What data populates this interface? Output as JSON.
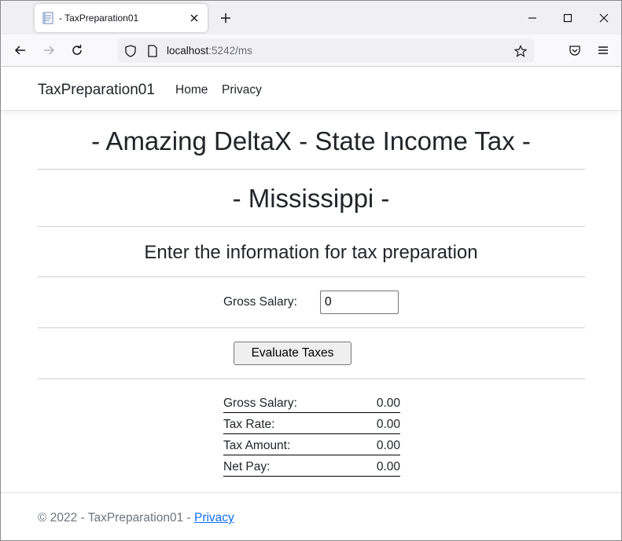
{
  "browser": {
    "tab_title": "- TaxPreparation01",
    "url_host": "localhost",
    "url_rest": ":5242/ms"
  },
  "site": {
    "brand": "TaxPreparation01",
    "nav": [
      "Home",
      "Privacy"
    ]
  },
  "main": {
    "title": "- Amazing DeltaX - State Income Tax -",
    "state": "- Mississippi -",
    "subtitle": "Enter the information for tax preparation",
    "gross_salary_label": "Gross Salary:",
    "gross_salary_value": "0",
    "evaluate_button": "Evaluate Taxes",
    "results": [
      {
        "label": "Gross Salary:",
        "value": "0.00"
      },
      {
        "label": "Tax Rate:",
        "value": "0.00"
      },
      {
        "label": "Tax Amount:",
        "value": "0.00"
      },
      {
        "label": "Net Pay:",
        "value": "0.00"
      }
    ]
  },
  "footer": {
    "text": "© 2022 - TaxPreparation01 - ",
    "privacy_link": "Privacy"
  },
  "icons": {
    "favicon": "document-icon",
    "back": "arrow-left-icon",
    "forward": "arrow-right-icon",
    "reload": "reload-icon",
    "shield": "shield-icon",
    "page": "page-info-icon",
    "bookmark": "star-icon",
    "pocket": "pocket-icon",
    "menu": "hamburger-menu-icon"
  }
}
